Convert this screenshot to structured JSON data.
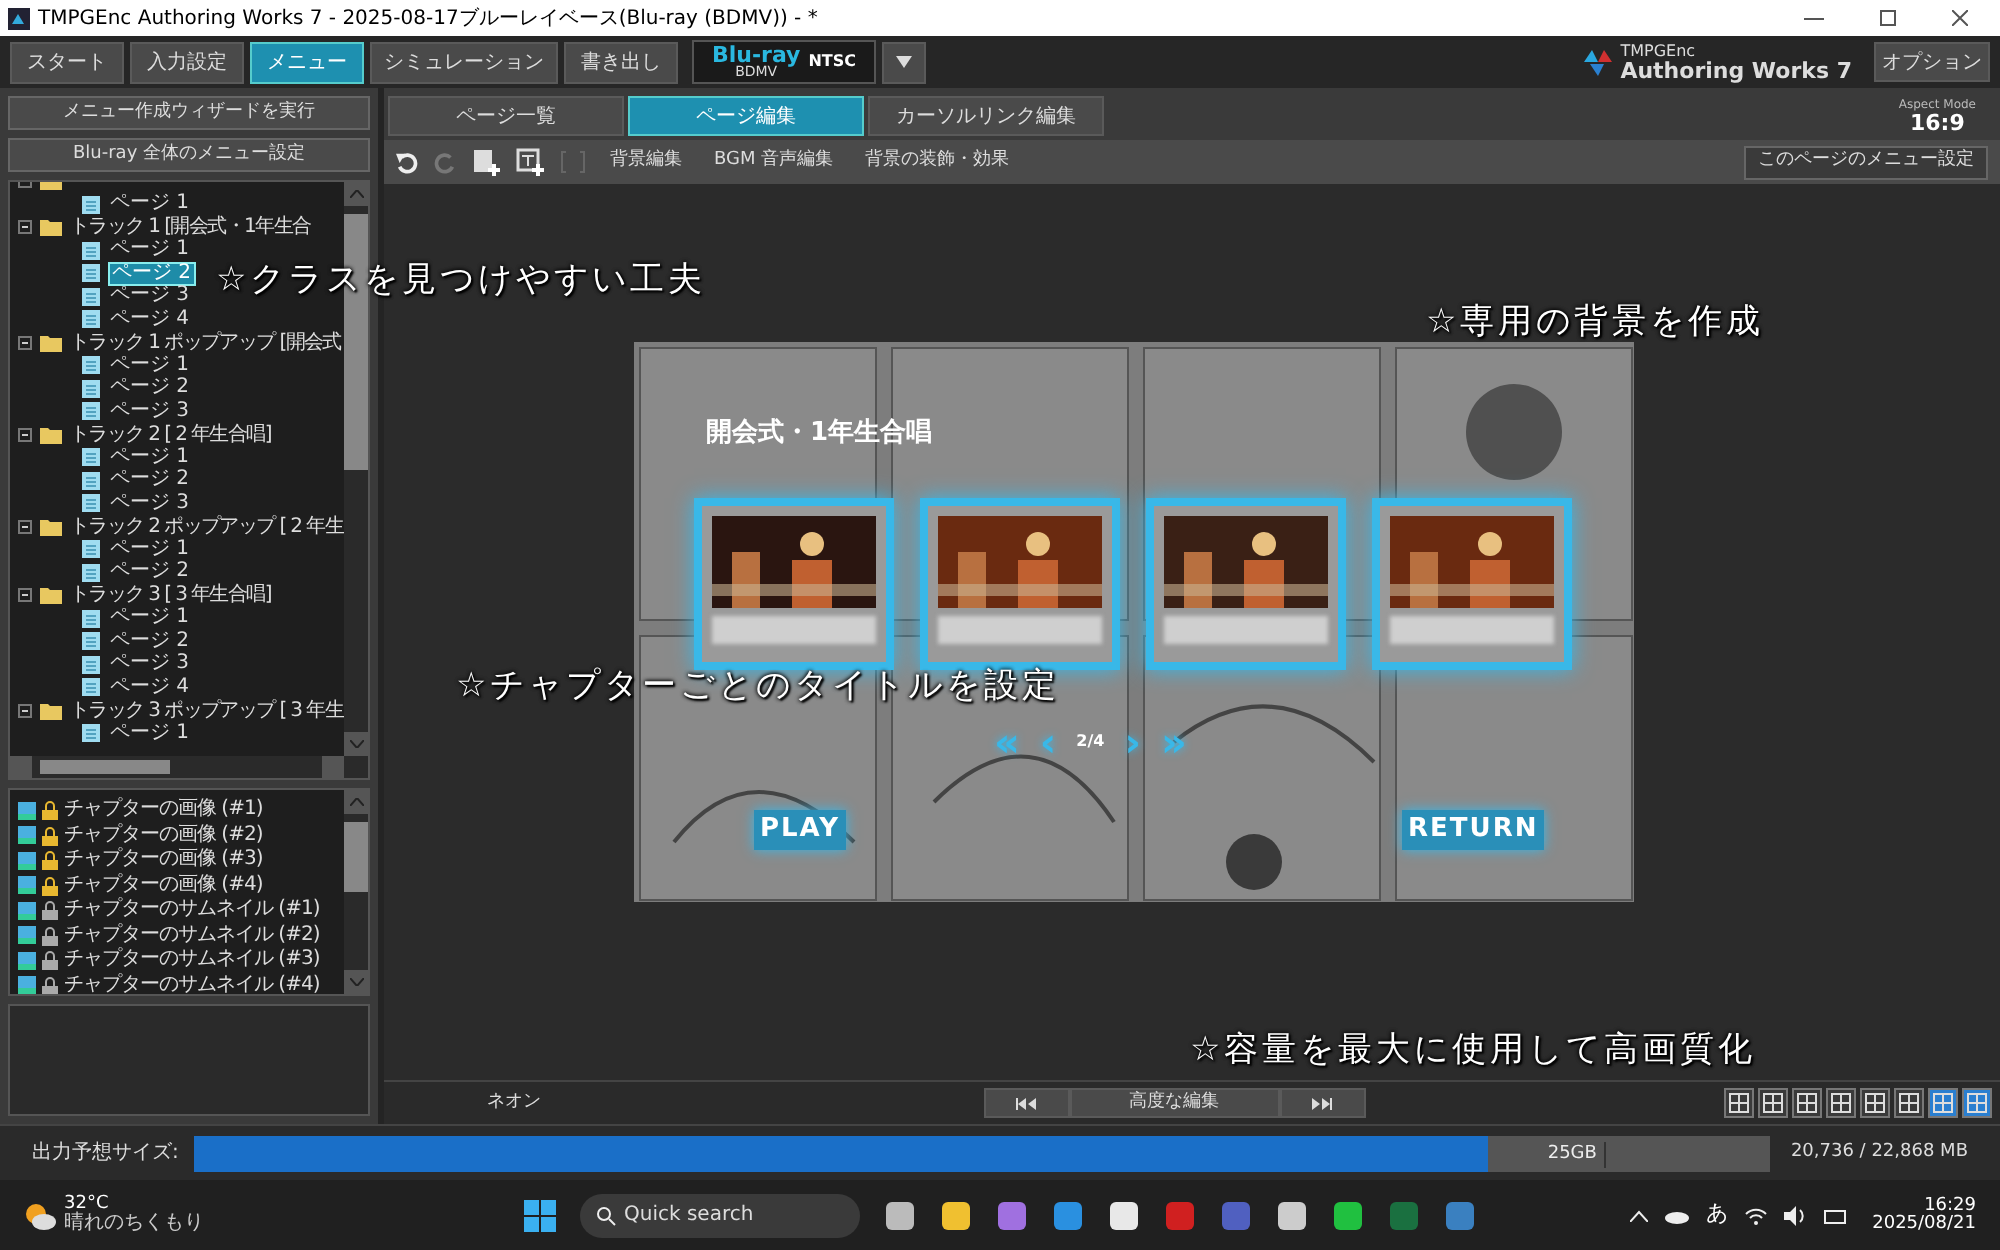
{
  "window": {
    "title": "TMPGEnc Authoring Works 7 - 2025-08-17ブルーレイベース(Blu-ray (BDMV)) - *"
  },
  "main_tabs": [
    {
      "label": "スタート",
      "selected": false
    },
    {
      "label": "入力設定",
      "selected": false
    },
    {
      "label": "メニュー",
      "selected": true
    },
    {
      "label": "シミュレーション",
      "selected": false
    },
    {
      "label": "書き出し",
      "selected": false
    }
  ],
  "disc": {
    "format": "Blu-ray",
    "type": "BDMV",
    "standard": "NTSC"
  },
  "logo": {
    "brand": "TMPGEnc",
    "product": "Authoring Works 7"
  },
  "options_button": "オプション",
  "sidebar": {
    "buttons": [
      "メニュー作成ウィザードを実行",
      "Blu-ray 全体のメニュー設定"
    ],
    "tree": [
      {
        "expanded": true,
        "children": [
          {
            "label": "ページ 1",
            "selected": false
          }
        ]
      },
      {
        "label": "トラック 1 [開会式・1年生合",
        "expanded": true,
        "children": [
          {
            "label": "ページ 1",
            "selected": false
          },
          {
            "label": "ページ 2",
            "selected": true
          },
          {
            "label": "ページ 3",
            "selected": false
          },
          {
            "label": "ページ 4",
            "selected": false
          }
        ]
      },
      {
        "label": "トラック 1 ポップアップ [開会式",
        "expanded": true,
        "children": [
          {
            "label": "ページ 1",
            "selected": false
          },
          {
            "label": "ページ 2",
            "selected": false
          },
          {
            "label": "ページ 3",
            "selected": false
          }
        ]
      },
      {
        "label": "トラック 2 [ 2 年生合唱]",
        "expanded": true,
        "children": [
          {
            "label": "ページ 1",
            "selected": false
          },
          {
            "label": "ページ 2",
            "selected": false
          },
          {
            "label": "ページ 3",
            "selected": false
          }
        ]
      },
      {
        "label": "トラック 2 ポップアップ [ 2 年生",
        "expanded": true,
        "children": [
          {
            "label": "ページ 1",
            "selected": false
          },
          {
            "label": "ページ 2",
            "selected": false
          }
        ]
      },
      {
        "label": "トラック 3 [ 3 年生合唱]",
        "expanded": true,
        "children": [
          {
            "label": "ページ 1",
            "selected": false
          },
          {
            "label": "ページ 2",
            "selected": false
          },
          {
            "label": "ページ 3",
            "selected": false
          },
          {
            "label": "ページ 4",
            "selected": false
          }
        ]
      },
      {
        "label": "トラック 3 ポップアップ [ 3 年生",
        "expanded": true,
        "children": [
          {
            "label": "ページ 1",
            "selected": false
          }
        ]
      }
    ],
    "objects": [
      {
        "label": "チャプターの画像 (#1)",
        "locked": true
      },
      {
        "label": "チャプターの画像 (#2)",
        "locked": true
      },
      {
        "label": "チャプターの画像 (#3)",
        "locked": true
      },
      {
        "label": "チャプターの画像 (#4)",
        "locked": true
      },
      {
        "label": "チャプターのサムネイル (#1)",
        "locked": false
      },
      {
        "label": "チャプターのサムネイル (#2)",
        "locked": false
      },
      {
        "label": "チャプターのサムネイル (#3)",
        "locked": false
      },
      {
        "label": "チャプターのサムネイル (#4)",
        "locked": false
      }
    ]
  },
  "page_tabs": [
    {
      "label": "ページ一覧",
      "selected": false
    },
    {
      "label": "ページ編集",
      "selected": true
    },
    {
      "label": "カーソルリンク編集",
      "selected": false
    }
  ],
  "aspect": {
    "label": "Aspect Mode",
    "value": "16:9"
  },
  "toolbar": {
    "items": [
      "背景編集",
      "BGM 音声編集",
      "背景の装飾・効果"
    ],
    "page_settings": "このページのメニュー設定"
  },
  "preview": {
    "title": "開会式・1年生合唱",
    "nav": [
      "«",
      "‹",
      "2/4",
      "›",
      "»"
    ],
    "play": "PLAY",
    "return": "RETURN"
  },
  "annotations": [
    "☆クラスを見つけやすい工夫",
    "☆専用の背景を作成",
    "☆チャプターごとのタイトルを設定",
    "☆容量を最大に使用して高画質化"
  ],
  "bottom_bar": {
    "effect": "ネオン",
    "advanced": "高度な編集"
  },
  "status": {
    "label": "出力予想サイズ:",
    "level": 0.82,
    "capacity": "25GB",
    "reading": "20,736 / 22,868 MB"
  },
  "taskbar": {
    "temperature": "32°C",
    "weather": "晴れのちくもり",
    "search": "Quick search",
    "ime": "あ",
    "time": "16:29",
    "date": "2025/08/21"
  }
}
